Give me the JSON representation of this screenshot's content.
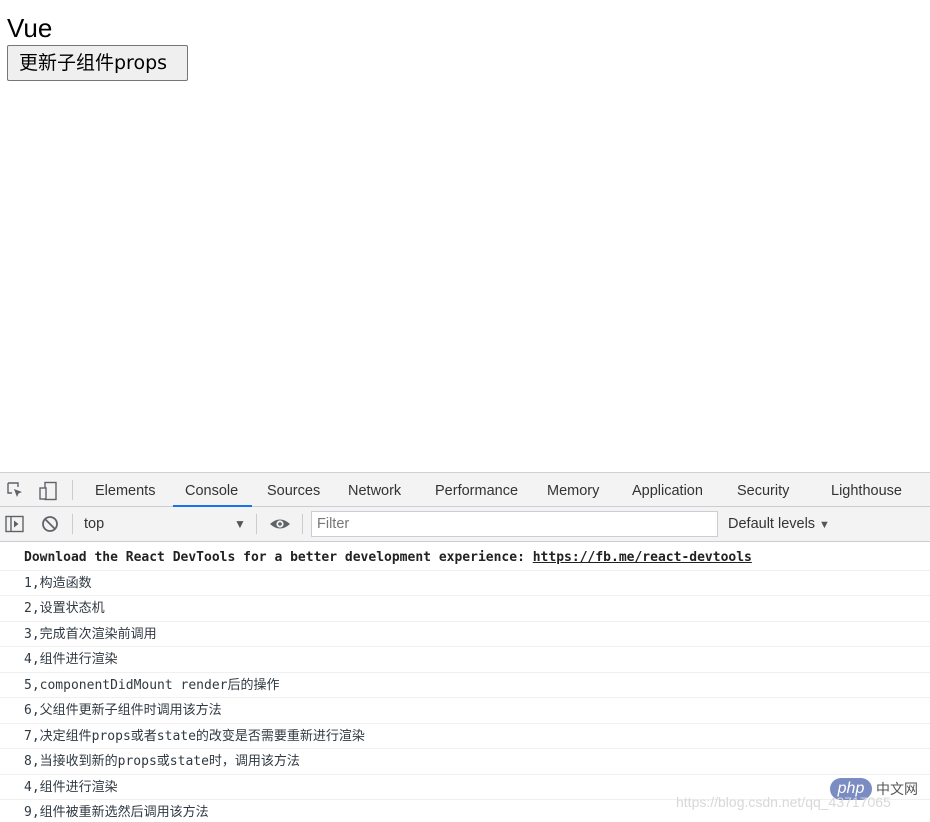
{
  "app": {
    "title": "Vue",
    "update_button": "更新子组件props"
  },
  "devtools": {
    "tabs": [
      "Elements",
      "Console",
      "Sources",
      "Network",
      "Performance",
      "Memory",
      "Application",
      "Security",
      "Lighthouse"
    ],
    "active_tab": "Console",
    "toolbar": {
      "context": "top",
      "filter_placeholder": "Filter",
      "levels": "Default levels"
    },
    "console": {
      "devtools_prefix": "Download the React DevTools for a better development experience: ",
      "devtools_link": "https://fb.me/react-devtools",
      "logs": [
        "1,构造函数",
        "2,设置状态机",
        "3,完成首次渲染前调用",
        "4,组件进行渲染",
        "5,componentDidMount render后的操作",
        "6,父组件更新子组件时调用该方法",
        "7,决定组件props或者state的改变是否需要重新进行渲染",
        "8,当接收到新的props或state时，调用该方法",
        "4,组件进行渲染",
        "9,组件被重新选然后调用该方法"
      ]
    },
    "colors": {
      "accent": "#1a73e8",
      "panel_bg": "#f3f3f3"
    }
  },
  "watermark": {
    "url": "https://blog.csdn.net/qq_43717065",
    "badge": "php",
    "cn": "中文网"
  }
}
